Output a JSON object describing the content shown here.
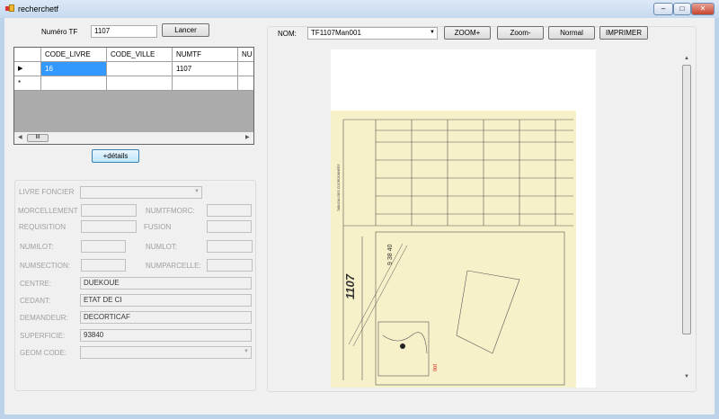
{
  "window": {
    "title": "recherchetf",
    "controls": [
      "minimize",
      "maximize",
      "close"
    ]
  },
  "search": {
    "label": "Numéro TF",
    "value": "1107",
    "button": "Lancer"
  },
  "grid": {
    "columns": [
      "CODE_LIVRE",
      "CODE_VILLE",
      "NUMTF",
      "NU"
    ],
    "rows": [
      [
        "16",
        "",
        "1107",
        ""
      ]
    ],
    "new_row_marker": "*",
    "current_row_marker": "▶"
  },
  "details_button": "+détails",
  "form": {
    "livre_foncier": {
      "label": "LIVRE FONCIER",
      "value": ""
    },
    "morcellement": {
      "label": "MORCELLEMENT",
      "value": ""
    },
    "numtfmorc": {
      "label": "NUMTFMORC:",
      "value": ""
    },
    "requisition": {
      "label": "REQUISITION",
      "value": ""
    },
    "fusion": {
      "label": "FUSION",
      "value": ""
    },
    "numilot": {
      "label": "NUMILOT:",
      "value": ""
    },
    "numlot": {
      "label": "NUMLOT:",
      "value": ""
    },
    "numsection": {
      "label": "NUMSECTION:",
      "value": ""
    },
    "numparcelle": {
      "label": "NUMPARCELLE:",
      "value": ""
    },
    "centre": {
      "label": "CENTRE:",
      "value": "DUEKOUE"
    },
    "cedant": {
      "label": "CEDANT:",
      "value": "ETAT DE CI"
    },
    "demandeur": {
      "label": "DEMANDEUR:",
      "value": "DECORTICAF"
    },
    "superficie": {
      "label": "SUPERFICIE:",
      "value": "93840"
    },
    "geom_code": {
      "label": "GEOM CODE:",
      "value": ""
    }
  },
  "viewer": {
    "nom_label": "NOM:",
    "nom_value": "TF1107Man001",
    "buttons": {
      "zoom_in": "ZOOM+",
      "zoom_out": "Zoom-",
      "normal": "Normal",
      "print": "IMPRIMER"
    },
    "scan": {
      "tf_number": "1107",
      "area": "9 38 40",
      "table_title": "TABLEAU DES COORDONNEES"
    }
  },
  "colors": {
    "selection": "#3399ff",
    "paper": "#f6f1c9"
  }
}
